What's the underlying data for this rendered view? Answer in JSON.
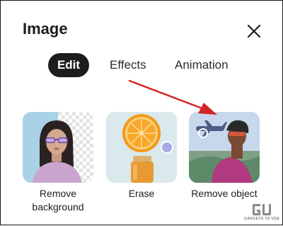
{
  "dialog": {
    "title": "Image",
    "close_icon": "close-icon"
  },
  "tabs": [
    {
      "label": "Edit",
      "selected": true
    },
    {
      "label": "Effects",
      "selected": false
    },
    {
      "label": "Animation",
      "selected": false
    }
  ],
  "tools": [
    {
      "label": "Remove background",
      "thumbnail": "person-with-transparent-background"
    },
    {
      "label": "Erase",
      "thumbnail": "orange-slice-on-juice-bottle"
    },
    {
      "label": "Remove object",
      "thumbnail": "cyclist-with-airplane-in-sky"
    }
  ],
  "annotation": {
    "arrow_color": "#d32424"
  },
  "watermark": {
    "logo": "GU",
    "tagline": "GADGETS TO USE"
  },
  "colors": {
    "tab_selected_bg": "#1d1d1d",
    "tab_selected_text": "#ffffff",
    "text": "#1d1d1d"
  }
}
